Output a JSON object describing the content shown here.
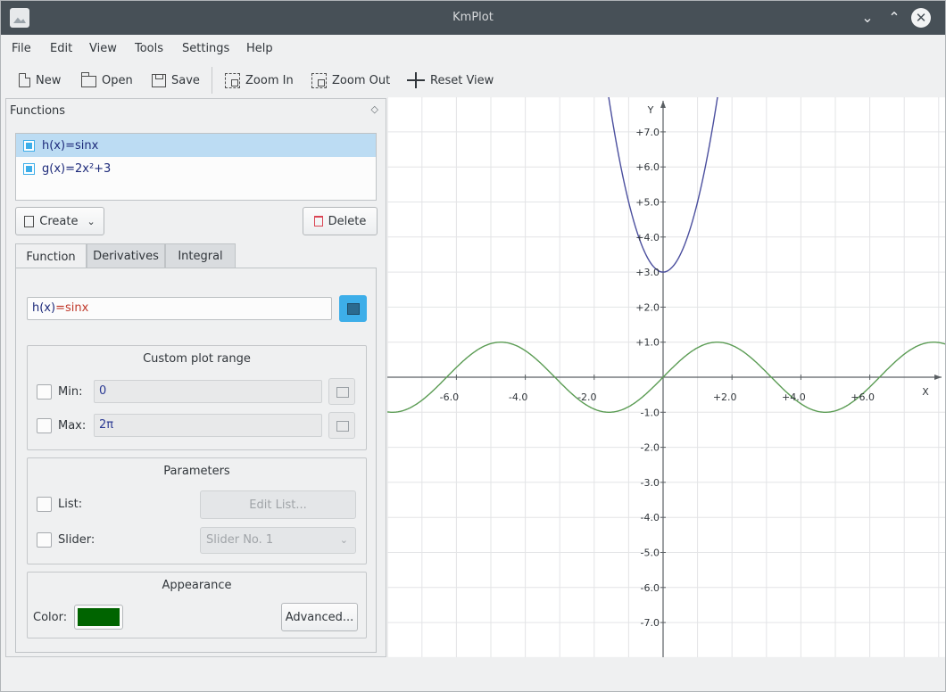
{
  "window": {
    "title": "KmPlot"
  },
  "menu": [
    "File",
    "Edit",
    "View",
    "Tools",
    "Settings",
    "Help"
  ],
  "toolbar": {
    "new": "New",
    "open": "Open",
    "save": "Save",
    "zoom_in": "Zoom In",
    "zoom_out": "Zoom Out",
    "reset_view": "Reset View"
  },
  "dock": {
    "title": "Functions",
    "functions": [
      {
        "label": "h(x)=sinx",
        "selected": true
      },
      {
        "label": "g(x)=2x²+3",
        "selected": false
      }
    ],
    "create_label": "Create",
    "delete_label": "Delete",
    "tabs": [
      "Function",
      "Derivatives",
      "Integral"
    ],
    "active_tab": "Function",
    "equation": {
      "name": "h(x)",
      "op": "=",
      "body": "sinx"
    },
    "plot_range": {
      "title": "Custom plot range",
      "min_label": "Min:",
      "min_value": "0",
      "max_label": "Max:",
      "max_value": "2π",
      "min_checked": false,
      "max_checked": false
    },
    "parameters": {
      "title": "Parameters",
      "list_label": "List:",
      "edit_list_label": "Edit List...",
      "slider_label": "Slider:",
      "slider_value": "Slider No. 1",
      "list_checked": false,
      "slider_checked": false
    },
    "appearance": {
      "title": "Appearance",
      "color_label": "Color:",
      "color_value": "#006400",
      "advanced_label": "Advanced..."
    }
  },
  "plot": {
    "x_axis_label": "X",
    "y_axis_label": "Y",
    "x_range": [
      -8,
      8
    ],
    "y_range": [
      -8,
      8
    ],
    "x_ticks": [
      "-6.0",
      "-4.0",
      "-2.0",
      "+2.0",
      "+4.0",
      "+6.0"
    ],
    "y_ticks": [
      "+7.0",
      "+6.0",
      "+5.0",
      "+4.0",
      "+3.0",
      "+2.0",
      "+1.0",
      "-1.0",
      "-2.0",
      "-3.0",
      "-4.0",
      "-5.0",
      "-6.0",
      "-7.0"
    ],
    "grid": true,
    "curves": [
      {
        "name": "h(x)=sinx",
        "color": "#5b9c54"
      },
      {
        "name": "g(x)=2x²+3",
        "color": "#4b4f9e"
      }
    ]
  }
}
